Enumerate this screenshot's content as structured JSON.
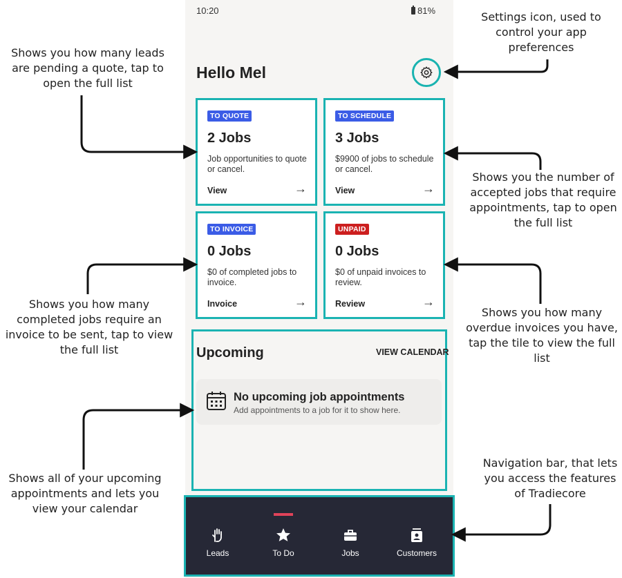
{
  "status_bar": {
    "time": "10:20",
    "battery": "81%"
  },
  "header": {
    "greeting": "Hello Mel"
  },
  "tiles": [
    {
      "badge": "TO QUOTE",
      "badge_color": "#3b5ce6",
      "count": "2 Jobs",
      "description": "Job opportunities to quote or cancel.",
      "action": "View"
    },
    {
      "badge": "TO SCHEDULE",
      "badge_color": "#3b5ce6",
      "count": "3 Jobs",
      "description": "$9900 of jobs to schedule or cancel.",
      "action": "View"
    },
    {
      "badge": "TO INVOICE",
      "badge_color": "#3b5ce6",
      "count": "0 Jobs",
      "description": "$0 of completed jobs to invoice.",
      "action": "Invoice"
    },
    {
      "badge": "UNPAID",
      "badge_color": "#cc1f1f",
      "count": "0 Jobs",
      "description": "$0 of unpaid invoices to review.",
      "action": "Review"
    }
  ],
  "arrow_glyph": "→",
  "upcoming": {
    "title": "Upcoming",
    "view_calendar": "VIEW CALENDAR",
    "empty_title": "No upcoming job appointments",
    "empty_subtitle": "Add appointments to a job for it to show here."
  },
  "nav": [
    {
      "label": "Leads",
      "icon": "hand-icon"
    },
    {
      "label": "To Do",
      "icon": "star-icon",
      "active": true
    },
    {
      "label": "Jobs",
      "icon": "briefcase-icon"
    },
    {
      "label": "Customers",
      "icon": "contact-card-icon"
    }
  ],
  "annotations": {
    "settings": "Settings icon, used to control your app preferences",
    "to_quote": "Shows you how many leads are pending a quote, tap to open the full list",
    "to_schedule": "Shows you the number of accepted jobs that require appointments, tap to open the full list",
    "to_invoice": "Shows you how many completed jobs require an invoice to be sent, tap to view the full list",
    "unpaid": "Shows you how many overdue invoices you have, tap the tile to view the full list",
    "upcoming": "Shows all of your upcoming appointments and lets you view your calendar",
    "navbar": "Navigation bar, that lets you access the features of Tradiecore"
  },
  "colors": {
    "accent_teal": "#1ab3b2",
    "nav_bg": "#262836",
    "active_indicator": "#e0435a"
  }
}
